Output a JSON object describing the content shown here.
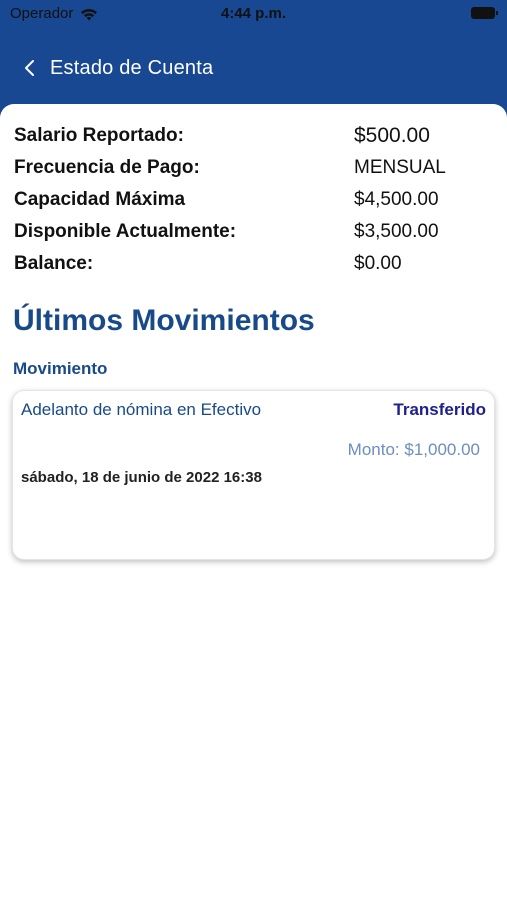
{
  "status_bar": {
    "carrier": "Operador",
    "time": "4:44 p.m."
  },
  "nav": {
    "title": "Estado de Cuenta"
  },
  "summary": [
    {
      "label": "Salario Reportado:",
      "value": "$500.00"
    },
    {
      "label": "Frecuencia de Pago:",
      "value": "MENSUAL"
    },
    {
      "label": "Capacidad Máxima",
      "value": "$4,500.00"
    },
    {
      "label": "Disponible Actualmente:",
      "value": "$3,500.00"
    },
    {
      "label": "Balance:",
      "value": "$0.00"
    }
  ],
  "movements": {
    "title": "Últimos Movimientos",
    "subhead": "Movimiento",
    "items": [
      {
        "description": "Adelanto de nómina en Efectivo",
        "status": "Transferido",
        "amount": "Monto: $1,000.00",
        "date": "sábado, 18 de junio de 2022 16:38"
      }
    ]
  },
  "colors": {
    "header": "#194892",
    "accent": "#184a8a",
    "status_text": "#1f1f8f",
    "amount_text": "#6c8ec0"
  },
  "icons": [
    "wifi-icon",
    "battery-icon",
    "back-chevron-icon"
  ]
}
